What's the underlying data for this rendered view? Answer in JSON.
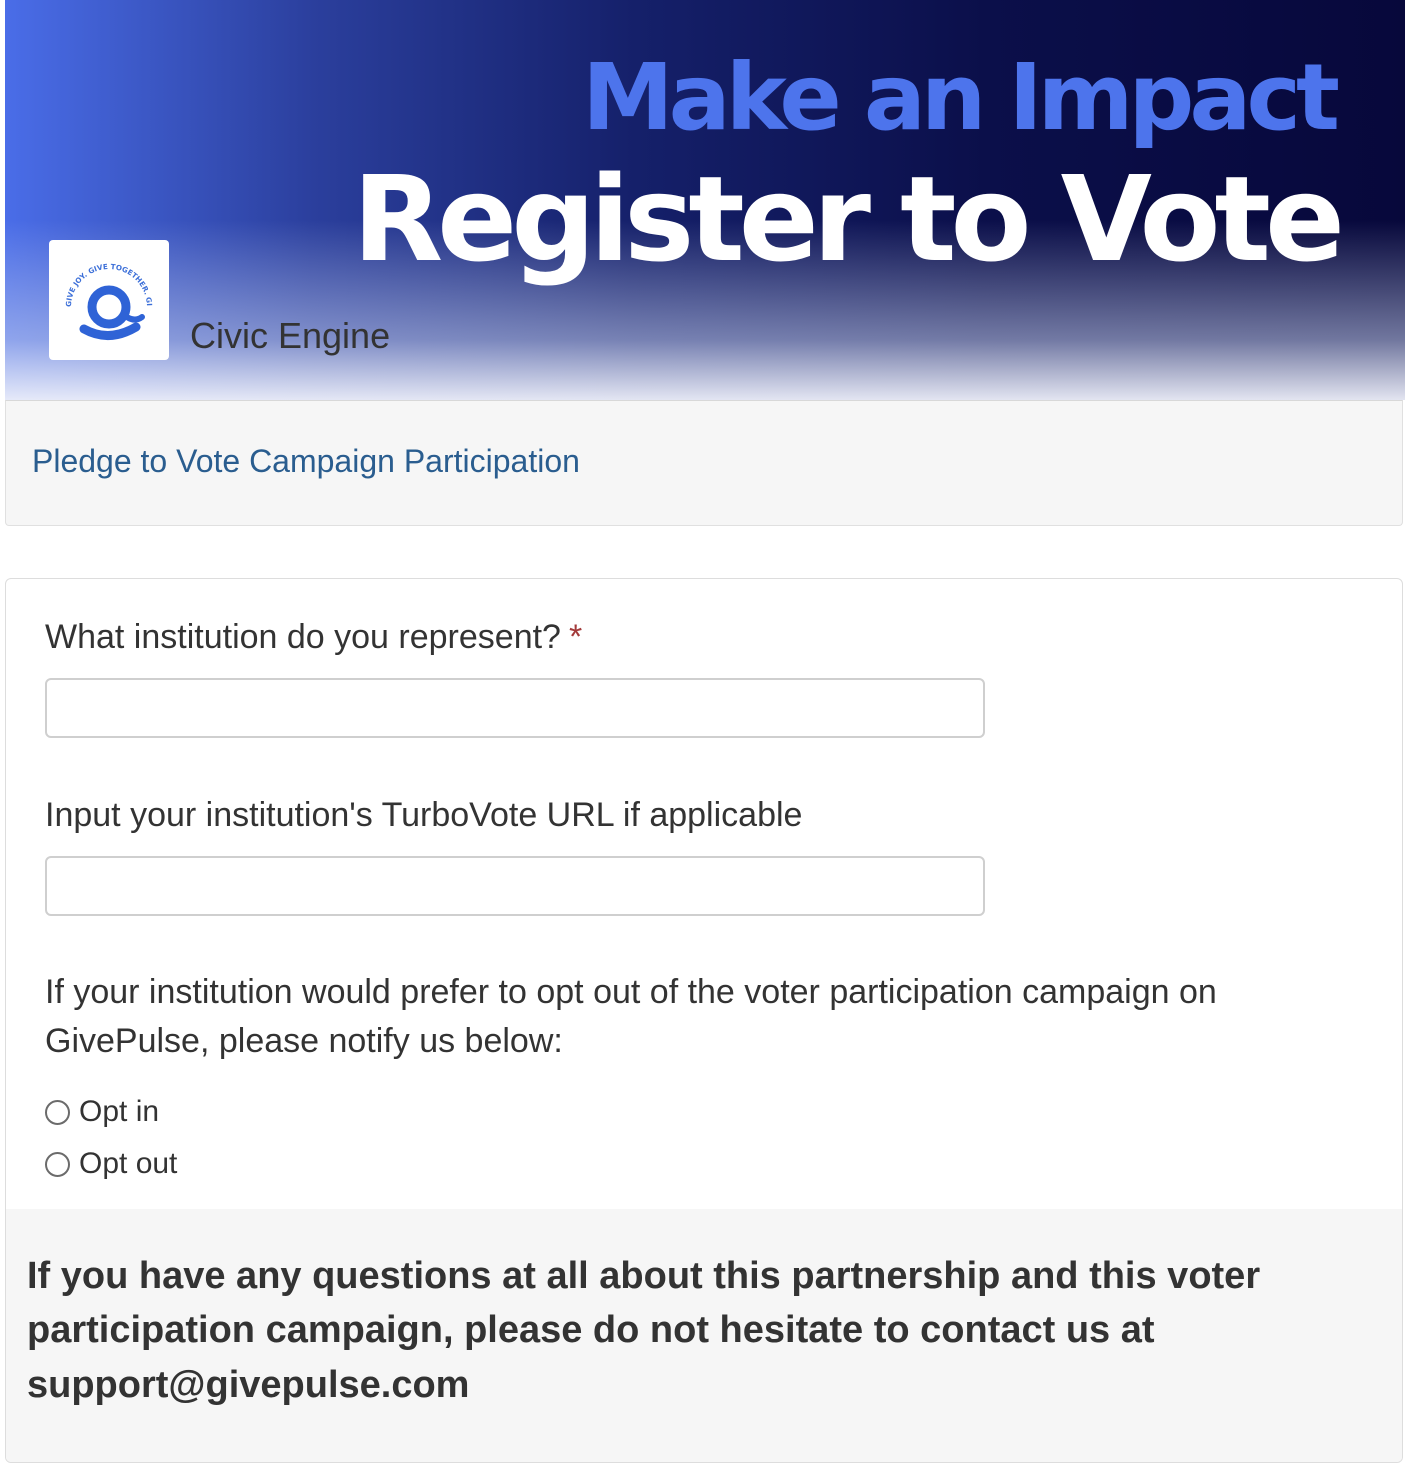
{
  "banner": {
    "headline": "Make an Impact",
    "subheadline": "Register to Vote",
    "logo_text": "GIVE JOY. GIVE TOGETHER. GIVE MORE.",
    "organization": "Civic Engine"
  },
  "page": {
    "title": "Pledge to Vote Campaign Participation"
  },
  "form": {
    "q1": {
      "label": "What institution do you represent?",
      "required_mark": "*",
      "value": "",
      "placeholder": ""
    },
    "q2": {
      "label": "Input your institution's TurboVote URL if applicable",
      "value": "",
      "placeholder": ""
    },
    "q3": {
      "label": "If your institution would prefer to opt out of the voter participation campaign on GivePulse, please notify us below:",
      "options": [
        {
          "label": "Opt in",
          "selected": false
        },
        {
          "label": "Opt out",
          "selected": false
        }
      ]
    },
    "footer_note": "If you have any questions at all about this partnership and this voter participation campaign, please do not hesitate to contact us at support@givepulse.com"
  },
  "colors": {
    "link": "#2a5d8f",
    "required": "#a33a3a",
    "banner_accent": "#4d74ec"
  }
}
